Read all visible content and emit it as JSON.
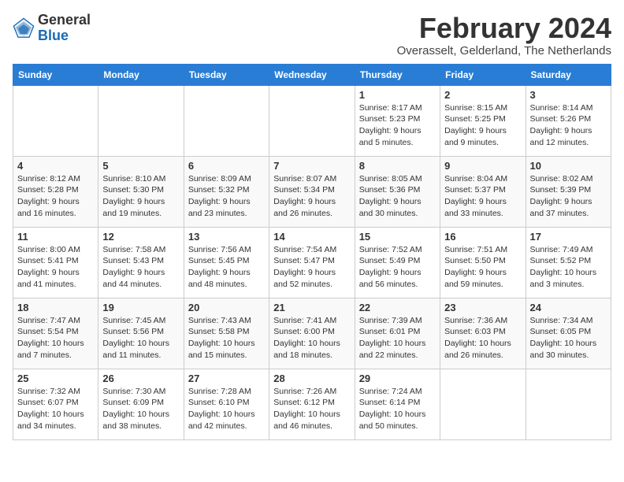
{
  "header": {
    "logo_general": "General",
    "logo_blue": "Blue",
    "month_year": "February 2024",
    "location": "Overasselt, Gelderland, The Netherlands"
  },
  "columns": [
    "Sunday",
    "Monday",
    "Tuesday",
    "Wednesday",
    "Thursday",
    "Friday",
    "Saturday"
  ],
  "weeks": [
    [
      {
        "day": "",
        "info": ""
      },
      {
        "day": "",
        "info": ""
      },
      {
        "day": "",
        "info": ""
      },
      {
        "day": "",
        "info": ""
      },
      {
        "day": "1",
        "info": "Sunrise: 8:17 AM\nSunset: 5:23 PM\nDaylight: 9 hours\nand 5 minutes."
      },
      {
        "day": "2",
        "info": "Sunrise: 8:15 AM\nSunset: 5:25 PM\nDaylight: 9 hours\nand 9 minutes."
      },
      {
        "day": "3",
        "info": "Sunrise: 8:14 AM\nSunset: 5:26 PM\nDaylight: 9 hours\nand 12 minutes."
      }
    ],
    [
      {
        "day": "4",
        "info": "Sunrise: 8:12 AM\nSunset: 5:28 PM\nDaylight: 9 hours\nand 16 minutes."
      },
      {
        "day": "5",
        "info": "Sunrise: 8:10 AM\nSunset: 5:30 PM\nDaylight: 9 hours\nand 19 minutes."
      },
      {
        "day": "6",
        "info": "Sunrise: 8:09 AM\nSunset: 5:32 PM\nDaylight: 9 hours\nand 23 minutes."
      },
      {
        "day": "7",
        "info": "Sunrise: 8:07 AM\nSunset: 5:34 PM\nDaylight: 9 hours\nand 26 minutes."
      },
      {
        "day": "8",
        "info": "Sunrise: 8:05 AM\nSunset: 5:36 PM\nDaylight: 9 hours\nand 30 minutes."
      },
      {
        "day": "9",
        "info": "Sunrise: 8:04 AM\nSunset: 5:37 PM\nDaylight: 9 hours\nand 33 minutes."
      },
      {
        "day": "10",
        "info": "Sunrise: 8:02 AM\nSunset: 5:39 PM\nDaylight: 9 hours\nand 37 minutes."
      }
    ],
    [
      {
        "day": "11",
        "info": "Sunrise: 8:00 AM\nSunset: 5:41 PM\nDaylight: 9 hours\nand 41 minutes."
      },
      {
        "day": "12",
        "info": "Sunrise: 7:58 AM\nSunset: 5:43 PM\nDaylight: 9 hours\nand 44 minutes."
      },
      {
        "day": "13",
        "info": "Sunrise: 7:56 AM\nSunset: 5:45 PM\nDaylight: 9 hours\nand 48 minutes."
      },
      {
        "day": "14",
        "info": "Sunrise: 7:54 AM\nSunset: 5:47 PM\nDaylight: 9 hours\nand 52 minutes."
      },
      {
        "day": "15",
        "info": "Sunrise: 7:52 AM\nSunset: 5:49 PM\nDaylight: 9 hours\nand 56 minutes."
      },
      {
        "day": "16",
        "info": "Sunrise: 7:51 AM\nSunset: 5:50 PM\nDaylight: 9 hours\nand 59 minutes."
      },
      {
        "day": "17",
        "info": "Sunrise: 7:49 AM\nSunset: 5:52 PM\nDaylight: 10 hours\nand 3 minutes."
      }
    ],
    [
      {
        "day": "18",
        "info": "Sunrise: 7:47 AM\nSunset: 5:54 PM\nDaylight: 10 hours\nand 7 minutes."
      },
      {
        "day": "19",
        "info": "Sunrise: 7:45 AM\nSunset: 5:56 PM\nDaylight: 10 hours\nand 11 minutes."
      },
      {
        "day": "20",
        "info": "Sunrise: 7:43 AM\nSunset: 5:58 PM\nDaylight: 10 hours\nand 15 minutes."
      },
      {
        "day": "21",
        "info": "Sunrise: 7:41 AM\nSunset: 6:00 PM\nDaylight: 10 hours\nand 18 minutes."
      },
      {
        "day": "22",
        "info": "Sunrise: 7:39 AM\nSunset: 6:01 PM\nDaylight: 10 hours\nand 22 minutes."
      },
      {
        "day": "23",
        "info": "Sunrise: 7:36 AM\nSunset: 6:03 PM\nDaylight: 10 hours\nand 26 minutes."
      },
      {
        "day": "24",
        "info": "Sunrise: 7:34 AM\nSunset: 6:05 PM\nDaylight: 10 hours\nand 30 minutes."
      }
    ],
    [
      {
        "day": "25",
        "info": "Sunrise: 7:32 AM\nSunset: 6:07 PM\nDaylight: 10 hours\nand 34 minutes."
      },
      {
        "day": "26",
        "info": "Sunrise: 7:30 AM\nSunset: 6:09 PM\nDaylight: 10 hours\nand 38 minutes."
      },
      {
        "day": "27",
        "info": "Sunrise: 7:28 AM\nSunset: 6:10 PM\nDaylight: 10 hours\nand 42 minutes."
      },
      {
        "day": "28",
        "info": "Sunrise: 7:26 AM\nSunset: 6:12 PM\nDaylight: 10 hours\nand 46 minutes."
      },
      {
        "day": "29",
        "info": "Sunrise: 7:24 AM\nSunset: 6:14 PM\nDaylight: 10 hours\nand 50 minutes."
      },
      {
        "day": "",
        "info": ""
      },
      {
        "day": "",
        "info": ""
      }
    ]
  ]
}
